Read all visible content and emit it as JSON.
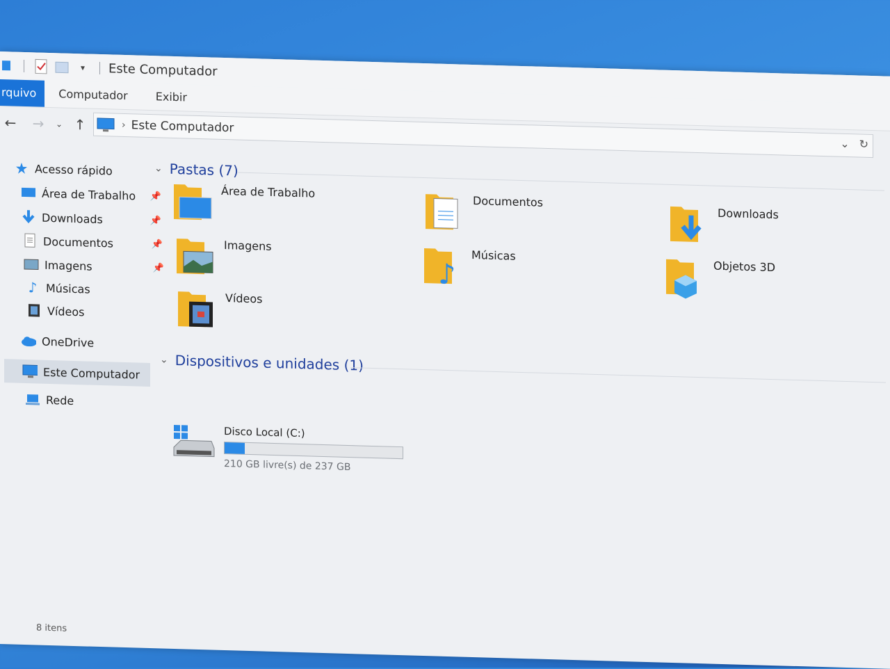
{
  "window": {
    "title": "Este Computador",
    "status": "8 itens"
  },
  "ribbon": {
    "tabs": [
      "rquivo",
      "Computador",
      "Exibir"
    ]
  },
  "address": {
    "path": "Este Computador"
  },
  "sidebar": {
    "items": [
      {
        "label": "Acesso rápido",
        "icon": "star-icon"
      },
      {
        "label": "Área de Trabalho",
        "icon": "desktop-icon",
        "pinned": true
      },
      {
        "label": "Downloads",
        "icon": "download-icon",
        "pinned": true
      },
      {
        "label": "Documentos",
        "icon": "document-icon",
        "pinned": true
      },
      {
        "label": "Imagens",
        "icon": "image-icon",
        "pinned": true
      },
      {
        "label": "Músicas",
        "icon": "music-icon"
      },
      {
        "label": "Vídeos",
        "icon": "video-icon"
      },
      {
        "label": "OneDrive",
        "icon": "cloud-icon"
      },
      {
        "label": "Este Computador",
        "icon": "computer-icon",
        "selected": true
      },
      {
        "label": "Rede",
        "icon": "network-icon"
      }
    ]
  },
  "folders": {
    "header": "Pastas (7)",
    "items": [
      {
        "label": "Área de Trabalho",
        "icon": "desktop-folder-icon"
      },
      {
        "label": "Documentos",
        "icon": "documents-folder-icon"
      },
      {
        "label": "Downloads",
        "icon": "downloads-folder-icon"
      },
      {
        "label": "Imagens",
        "icon": "pictures-folder-icon"
      },
      {
        "label": "Músicas",
        "icon": "music-folder-icon"
      },
      {
        "label": "Objetos 3D",
        "icon": "3d-objects-folder-icon"
      },
      {
        "label": "Vídeos",
        "icon": "videos-folder-icon"
      }
    ]
  },
  "devices": {
    "header": "Dispositivos e unidades (1)",
    "drive": {
      "name": "Disco Local (C:)",
      "free": "210 GB livre(s) de 237 GB",
      "used_fraction": 0.114
    }
  },
  "colors": {
    "accent": "#1a73d8",
    "group_header": "#1f3f9c",
    "folder_yellow": "#f5c542"
  }
}
